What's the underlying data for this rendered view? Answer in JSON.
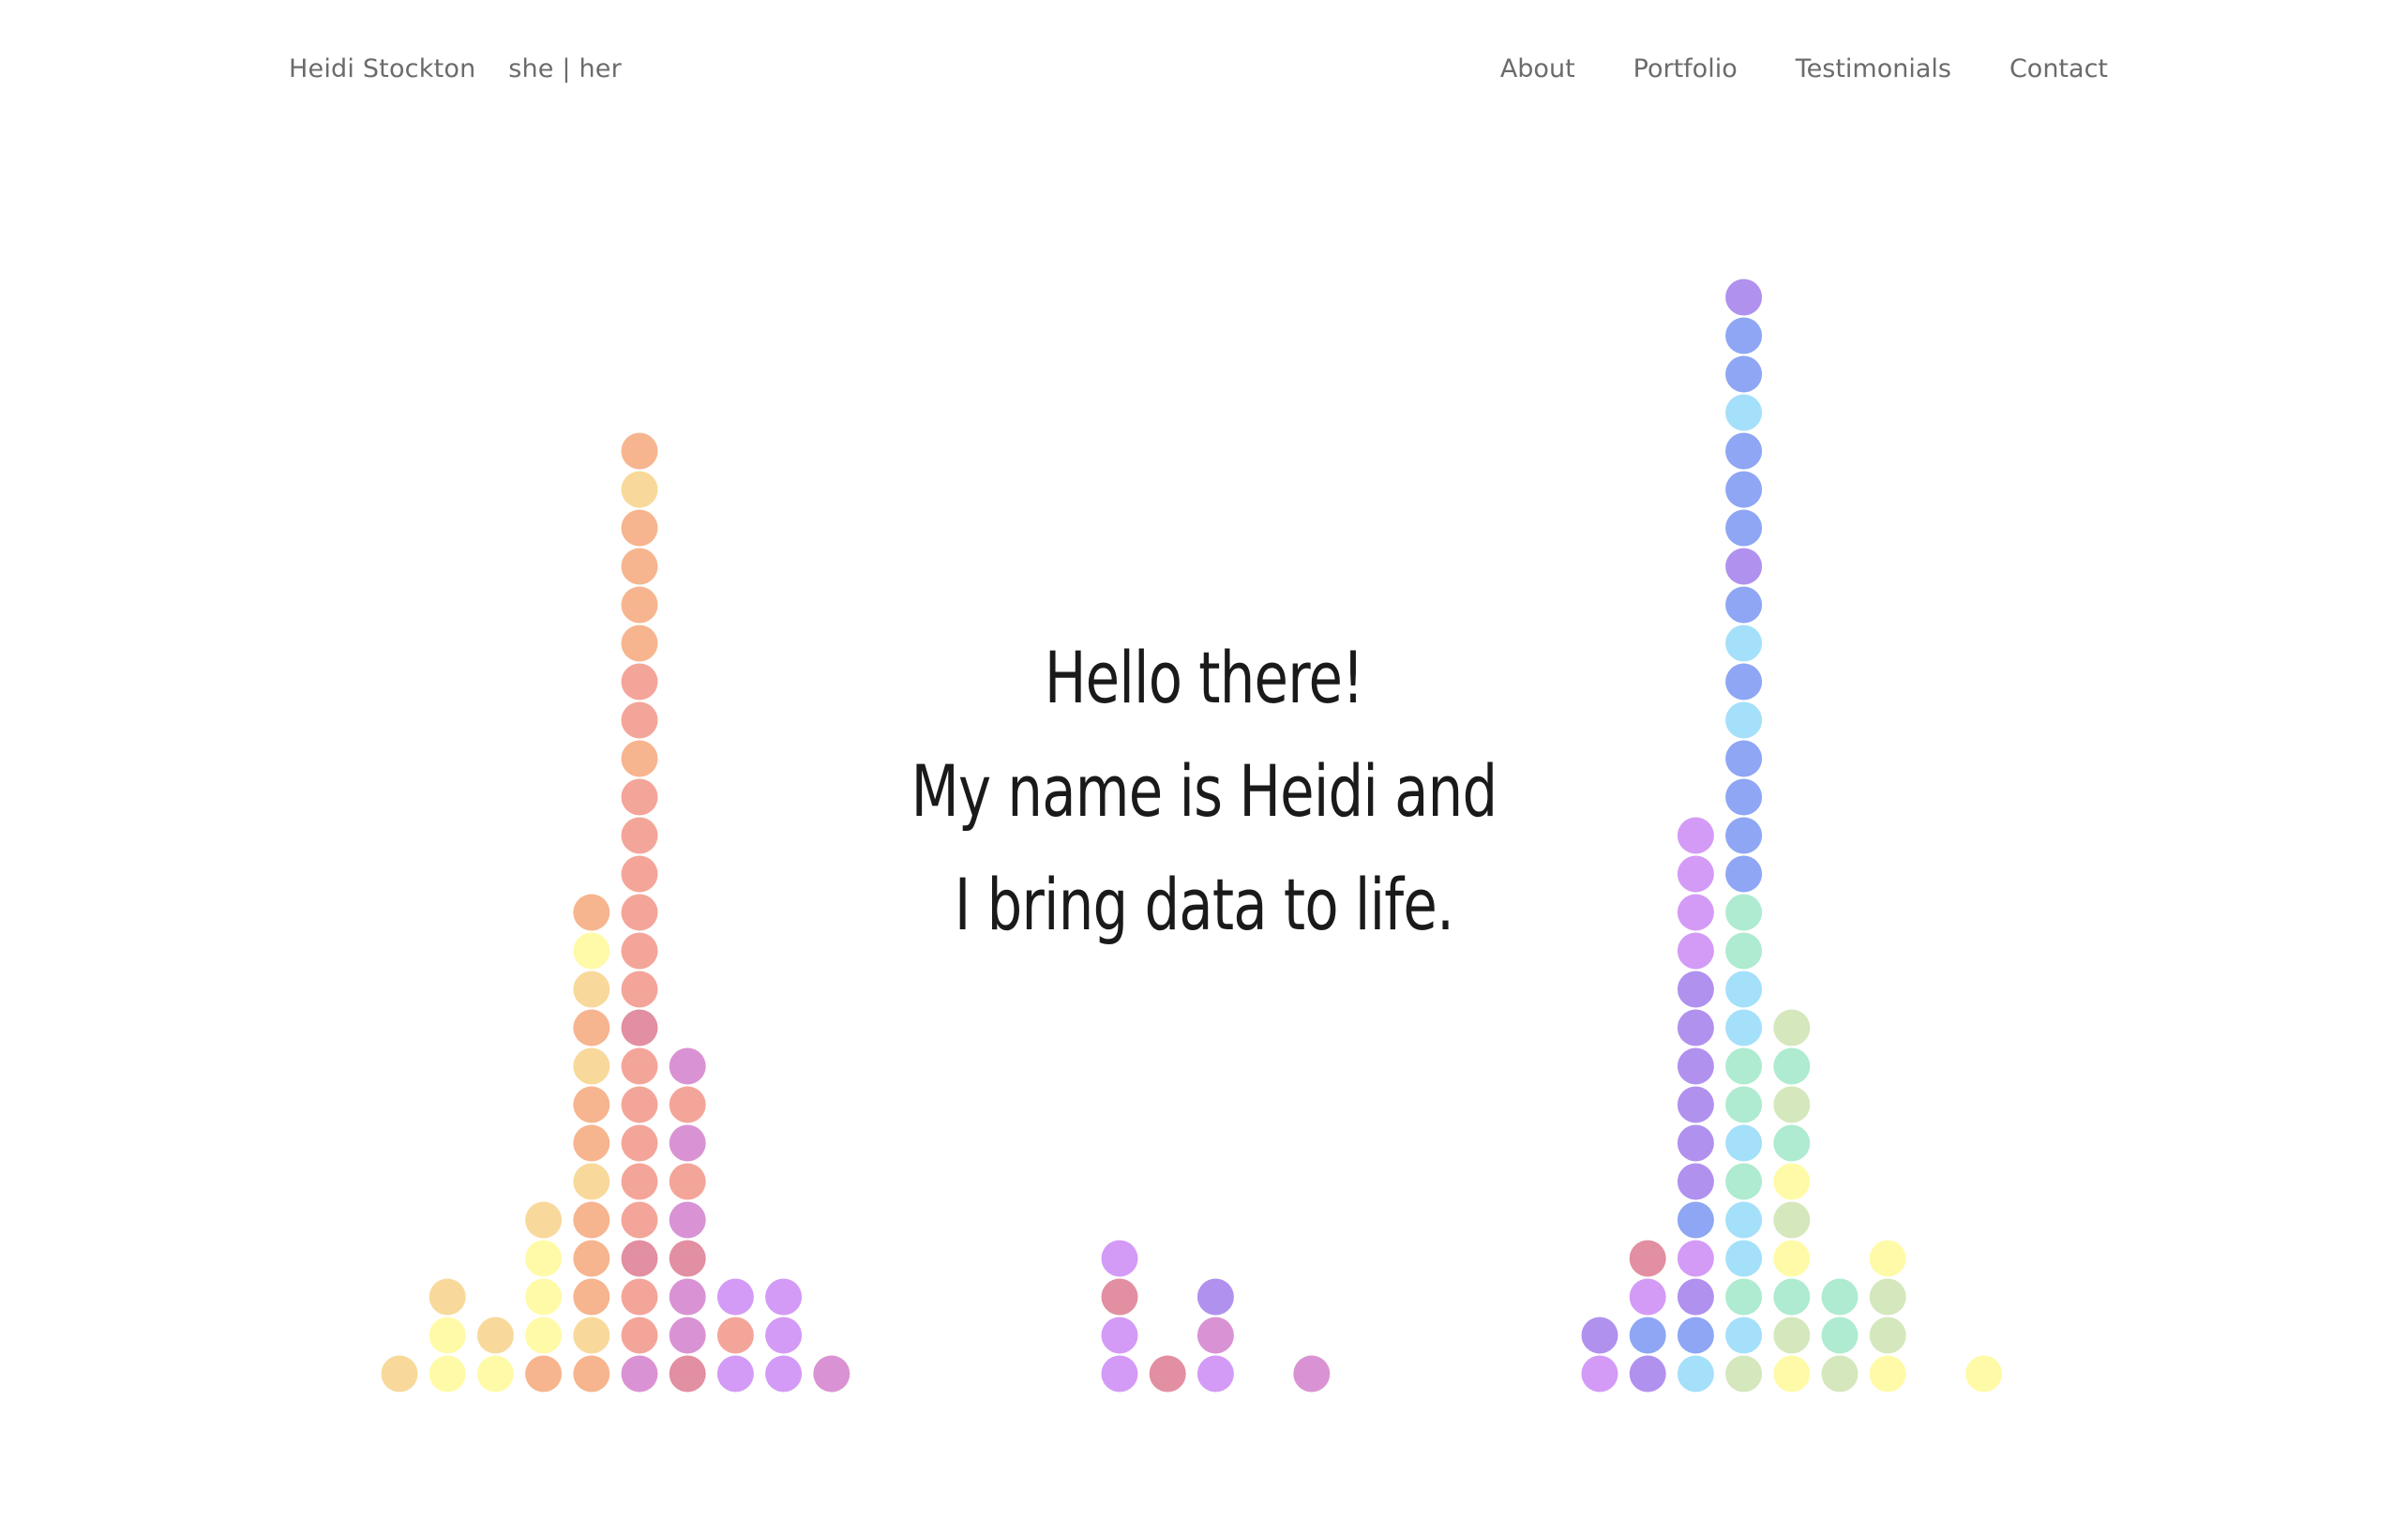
{
  "header": {
    "name": "Heidi Stockton",
    "pronouns": "she | her"
  },
  "nav": {
    "items": [
      {
        "label": "About"
      },
      {
        "label": "Portfolio"
      },
      {
        "label": "Testimonials"
      },
      {
        "label": "Contact"
      }
    ]
  },
  "hero": {
    "line1": "Hello there!",
    "line2": "My name is Heidi and",
    "line3": "I bring data to life."
  },
  "palette": {
    "a": "#f8d99b",
    "b": "#fffaa8",
    "c": "#f6b58f",
    "d": "#f4a59a",
    "e": "#e18fa1",
    "f": "#d993d4",
    "g": "#d49bf6",
    "h": "#b191ee",
    "i": "#8ea6f4",
    "j": "#a4e0fa",
    "k": "#aeebd0",
    "l": "#d5e7bc"
  },
  "chart_data": {
    "type": "scatter",
    "description_note": "",
    "columns": [
      {
        "stack": [
          "a"
        ]
      },
      {
        "stack": [
          "b",
          "b",
          "a"
        ]
      },
      {
        "stack": [
          "b",
          "a"
        ]
      },
      {
        "stack": [
          "c",
          "b",
          "b",
          "b",
          "a"
        ]
      },
      {
        "stack": [
          "c",
          "a",
          "c",
          "c",
          "c",
          "a",
          "c",
          "c",
          "a",
          "c",
          "a",
          "b",
          "c"
        ]
      },
      {
        "stack": [
          "f",
          "d",
          "d",
          "e",
          "d",
          "d",
          "d",
          "d",
          "d",
          "e",
          "d",
          "d",
          "d",
          "d",
          "d",
          "d",
          "c",
          "d",
          "d",
          "c",
          "c",
          "c",
          "c",
          "a",
          "c"
        ]
      },
      {
        "stack": [
          "e",
          "f",
          "f",
          "e",
          "f",
          "d",
          "f",
          "d",
          "f"
        ]
      },
      {
        "stack": [
          "g",
          "d",
          "g"
        ]
      },
      {
        "stack": [
          "g",
          "g",
          "g"
        ]
      },
      {
        "stack": [
          "f"
        ]
      },
      {
        "stack": []
      },
      {
        "stack": []
      },
      {
        "stack": []
      },
      {
        "stack": []
      },
      {
        "stack": []
      },
      {
        "stack": [
          "g",
          "g",
          "e",
          "g"
        ]
      },
      {
        "stack": [
          "e"
        ]
      },
      {
        "stack": [
          "g",
          "f",
          "h"
        ]
      },
      {
        "stack": []
      },
      {
        "stack": [
          "f"
        ]
      },
      {
        "stack": []
      },
      {
        "stack": []
      },
      {
        "stack": []
      },
      {
        "stack": []
      },
      {
        "stack": []
      },
      {
        "stack": [
          "g",
          "h"
        ]
      },
      {
        "stack": [
          "h",
          "i",
          "g",
          "e"
        ]
      },
      {
        "stack": [
          "j",
          "i",
          "h",
          "g",
          "i",
          "h",
          "h",
          "h",
          "h",
          "h",
          "h",
          "g",
          "g",
          "g",
          "g"
        ]
      },
      {
        "stack": [
          "l",
          "j",
          "k",
          "j",
          "j",
          "k",
          "j",
          "k",
          "k",
          "j",
          "j",
          "k",
          "k",
          "i",
          "i",
          "i",
          "i",
          "j",
          "i",
          "j",
          "i",
          "h",
          "i",
          "i",
          "i",
          "j",
          "i",
          "i",
          "h"
        ]
      },
      {
        "stack": [
          "b",
          "l",
          "k",
          "b",
          "l",
          "b",
          "k",
          "l",
          "k",
          "l"
        ]
      },
      {
        "stack": [
          "l",
          "k",
          "k"
        ]
      },
      {
        "stack": [
          "b",
          "l",
          "l",
          "b"
        ]
      },
      {
        "stack": []
      },
      {
        "stack": [
          "b"
        ]
      }
    ]
  }
}
